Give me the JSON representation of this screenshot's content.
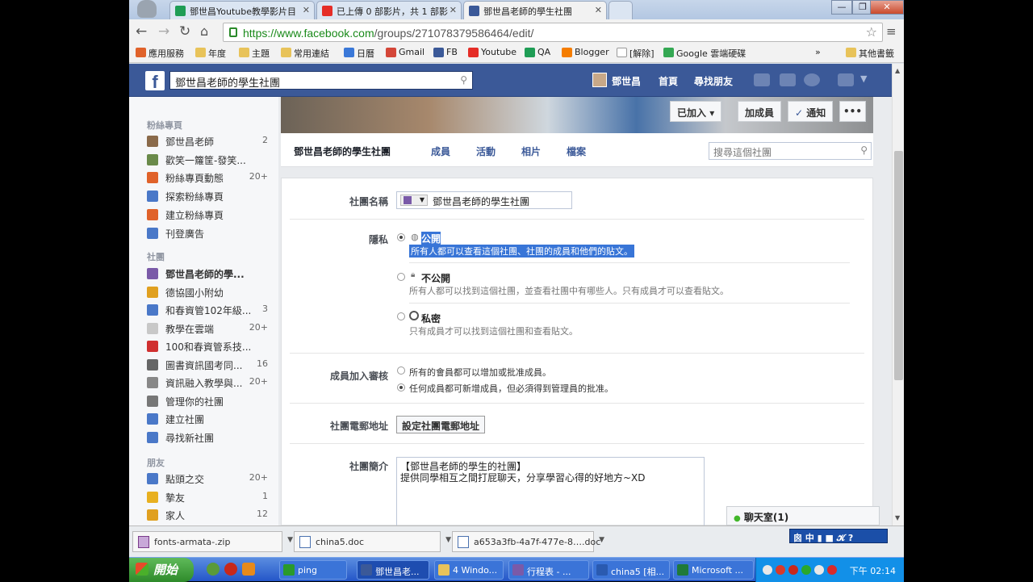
{
  "browser": {
    "tabs": [
      {
        "label": "鄧世昌Youtube教學影片目",
        "icon": "sheets-icon",
        "color": "#1f9d55"
      },
      {
        "label": "已上傳 0 部影片，共 1 部影",
        "icon": "youtube-icon",
        "color": "#e52d27"
      },
      {
        "label": "鄧世昌老師的學生社團",
        "icon": "facebook-icon",
        "color": "#3b5998"
      }
    ],
    "url_host": "https://www.facebook.com",
    "url_path": "/groups/271078379586464/edit/",
    "bookmarks": [
      {
        "label": "應用服務",
        "color": "#e0622a"
      },
      {
        "label": "年度",
        "color": "#e8c35a"
      },
      {
        "label": "主題",
        "color": "#e8c35a"
      },
      {
        "label": "常用連結",
        "color": "#e8c35a"
      },
      {
        "label": "日曆",
        "color": "#3a78d8"
      },
      {
        "label": "Gmail",
        "color": "#d44638"
      },
      {
        "label": "FB",
        "color": "#3b5998"
      },
      {
        "label": "Youtube",
        "color": "#e52d27"
      },
      {
        "label": "QA",
        "color": "#1f9d55"
      },
      {
        "label": "Blogger",
        "color": "#f57d00"
      },
      {
        "label": "[解除]",
        "color": "#cccccc"
      },
      {
        "label": "Google 雲端硬碟",
        "color": "#34a853"
      }
    ],
    "more_bookmarks": "»",
    "other_bookmarks": "其他書籤"
  },
  "fb": {
    "search_value": "鄧世昌老師的學生社團",
    "user_name": "鄧世昌",
    "nav_home": "首頁",
    "nav_find_friends": "尋找朋友"
  },
  "leftnav": {
    "fanpages_header": "粉絲專頁",
    "fanpages": [
      {
        "label": "鄧世昌老師",
        "count": "2",
        "color": "#8a6a4a"
      },
      {
        "label": "歡笑一籮筐-發笑...",
        "count": "",
        "color": "#6a8a4a"
      },
      {
        "label": "粉絲專頁動態",
        "count": "20+",
        "color": "#e0622a"
      },
      {
        "label": "探索粉絲專頁",
        "count": "",
        "color": "#4a78c8"
      },
      {
        "label": "建立粉絲專頁",
        "count": "",
        "color": "#e0622a"
      },
      {
        "label": "刊登廣告",
        "count": "",
        "color": "#4a78c8"
      }
    ],
    "groups_header": "社團",
    "groups": [
      {
        "label": "鄧世昌老師的學...",
        "count": "",
        "color": "#7a5aa8",
        "selected": true
      },
      {
        "label": "德協國小附幼",
        "count": "",
        "color": "#e0a020"
      },
      {
        "label": "和春資管102年級...",
        "count": "3",
        "color": "#4a78c8"
      },
      {
        "label": "教學在雲端",
        "count": "20+",
        "color": "#c8c8c8"
      },
      {
        "label": "100和春資管系技...",
        "count": "",
        "color": "#d03030"
      },
      {
        "label": "圖書資訊國考同...",
        "count": "16",
        "color": "#666666"
      },
      {
        "label": "資訊融入教學與...",
        "count": "20+",
        "color": "#888888"
      },
      {
        "label": "管理你的社團",
        "count": "",
        "color": "#777777"
      },
      {
        "label": "建立社團",
        "count": "",
        "color": "#4a78c8"
      },
      {
        "label": "尋找新社團",
        "count": "",
        "color": "#4a78c8"
      }
    ],
    "friends_header": "朋友",
    "friends": [
      {
        "label": "點頭之交",
        "count": "20+",
        "color": "#4a78c8"
      },
      {
        "label": "摯友",
        "count": "1",
        "color": "#e8b020"
      },
      {
        "label": "家人",
        "count": "12",
        "color": "#e0a020"
      }
    ]
  },
  "group": {
    "btn_joined": "已加入",
    "btn_add_member": "加成員",
    "btn_notify": "通知",
    "btn_more": "•••",
    "tabs": [
      "鄧世昌老師的學生社團",
      "成員",
      "活動",
      "相片",
      "檔案"
    ],
    "search_placeholder": "搜尋這個社團"
  },
  "settings": {
    "name_label": "社團名稱",
    "name_value": "鄧世昌老師的學生社團",
    "privacy_label": "隱私",
    "privacy_options": [
      {
        "title": "公開",
        "desc": "所有人都可以查看這個社團、社團的成員和他們的貼文。",
        "checked": true
      },
      {
        "title": "不公開",
        "desc": "所有人都可以找到這個社團，並查看社團中有哪些人。只有成員才可以查看貼文。",
        "checked": false
      },
      {
        "title": "私密",
        "desc": "只有成員才可以找到這個社團和查看貼文。",
        "checked": false
      }
    ],
    "approval_label": "成員加入審核",
    "approval_options": [
      {
        "label": "所有的會員都可以增加或批准成員。",
        "checked": false
      },
      {
        "label": "任何成員都可新增成員，但必須得到管理員的批准。",
        "checked": true
      }
    ],
    "email_label": "社團電郵地址",
    "email_button": "設定社團電郵地址",
    "desc_label": "社團簡介",
    "desc_value": "【鄧世昌老師的學生的社團】\n提供同學相互之間打屁聊天，分享學習心得的好地方~XD",
    "chat_label": "聊天室(1)"
  },
  "downloads": [
    {
      "label": "fonts-armata-.zip"
    },
    {
      "label": "china5.doc"
    },
    {
      "label": "a653a3fb-4a7f-477e-8….doc"
    }
  ],
  "ime": "囪 中 ▮ ■ 𝓚 ?",
  "taskbar": {
    "start": "開始",
    "items": [
      {
        "label": "ping",
        "color": "#2a9a2a"
      },
      {
        "label": "鄧世昌老...",
        "color": "#3b5998",
        "active": true
      },
      {
        "label": "4 Windo...",
        "color": "#e8c35a"
      },
      {
        "label": "行程表 - ...",
        "color": "#7a5aa8"
      },
      {
        "label": "china5 [相...",
        "color": "#2a5ab0"
      },
      {
        "label": "Microsoft ...",
        "color": "#1f7a3a"
      }
    ],
    "clock": "下午 02:14"
  }
}
